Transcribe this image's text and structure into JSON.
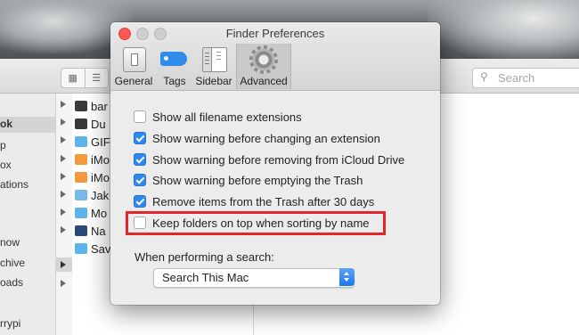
{
  "finder": {
    "search_placeholder": "Search",
    "sidebar_items": [
      "ok",
      "p",
      "ox",
      "ations",
      "now",
      "chive",
      "oads",
      "rrypi"
    ],
    "files": [
      "bar",
      "Du",
      "GIF",
      "iMo",
      "iMo",
      "Jak",
      "Mo",
      "Na",
      "Sav"
    ]
  },
  "prefs": {
    "title": "Finder Preferences",
    "tabs": [
      {
        "label": "General"
      },
      {
        "label": "Tags"
      },
      {
        "label": "Sidebar"
      },
      {
        "label": "Advanced",
        "selected": true
      }
    ],
    "options": [
      {
        "label": "Show all filename extensions",
        "checked": false
      },
      {
        "label": "Show warning before changing an extension",
        "checked": true
      },
      {
        "label": "Show warning before removing from iCloud Drive",
        "checked": true
      },
      {
        "label": "Show warning before emptying the Trash",
        "checked": true
      },
      {
        "label": "Remove items from the Trash after 30 days",
        "checked": true
      },
      {
        "label": "Keep folders on top when sorting by name",
        "checked": false,
        "highlighted": true
      }
    ],
    "search_label": "When performing a search:",
    "search_scope": "Search This Mac",
    "highlight_color": "#e4252a",
    "accent_color": "#2d89f0"
  }
}
